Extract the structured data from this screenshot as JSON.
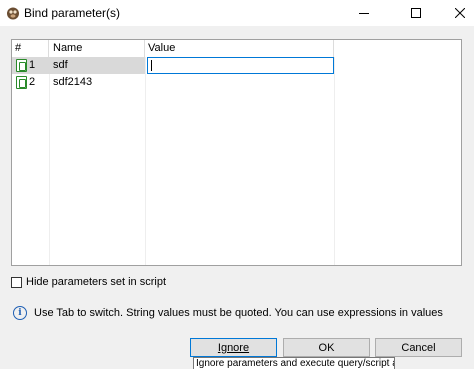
{
  "window": {
    "title": "Bind parameter(s)",
    "app_icon": "app-logo-icon",
    "controls": {
      "minimize": "minimize-icon",
      "maximize": "maximize-icon",
      "close": "close-icon"
    }
  },
  "table": {
    "headers": {
      "number": "#",
      "name": "Name",
      "value": "Value"
    },
    "rows": [
      {
        "number": "1",
        "name": "sdf",
        "value": "",
        "icon": "parameter-icon",
        "selected": true
      },
      {
        "number": "2",
        "name": "sdf2143",
        "value": "",
        "icon": "parameter-icon",
        "selected": false
      }
    ]
  },
  "options": {
    "hide_params_label": "Hide parameters set in script",
    "hide_params_checked": false
  },
  "info": {
    "icon": "info-icon",
    "text": "Use Tab to switch. String values must be quoted. You can use expressions in values"
  },
  "buttons": {
    "ignore": "Ignore",
    "ok": "OK",
    "cancel": "Cancel"
  },
  "tooltip": {
    "text": "Ignore parameters and execute query/script as is"
  },
  "colors": {
    "accent": "#0078d7",
    "selected_row": "#d9d9d9",
    "param_icon": "#2a8a2a"
  }
}
